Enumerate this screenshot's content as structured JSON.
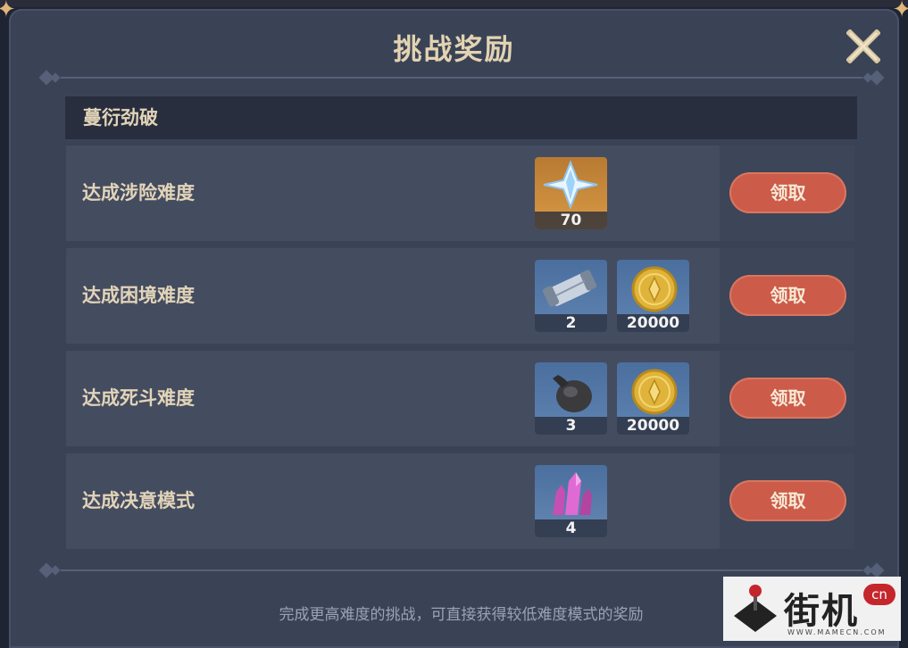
{
  "title": "挑战奖励",
  "section": "蔓衍劲破",
  "claim_label": "领取",
  "rows": [
    {
      "label": "达成涉险难度",
      "items": [
        {
          "icon": "primogem-icon",
          "count": "70"
        }
      ]
    },
    {
      "label": "达成困境难度",
      "items": [
        {
          "icon": "scroll-icon",
          "count": "2"
        },
        {
          "icon": "mora-coin-icon",
          "count": "20000"
        }
      ]
    },
    {
      "label": "达成死斗难度",
      "items": [
        {
          "icon": "pouch-icon",
          "count": "3"
        },
        {
          "icon": "mora-coin-icon",
          "count": "20000"
        }
      ]
    },
    {
      "label": "达成决意模式",
      "items": [
        {
          "icon": "crystal-icon",
          "count": "4"
        }
      ]
    }
  ],
  "footer": "完成更高难度的挑战，可直接获得较低难度模式的奖励",
  "watermark": {
    "chars": "街机",
    "badge": "cn",
    "url": "WWW.MAMECN.COM"
  },
  "colors": {
    "claim_button": "#cc5b4a",
    "title_text": "#e3d3b1",
    "panel": "#3a4356"
  }
}
